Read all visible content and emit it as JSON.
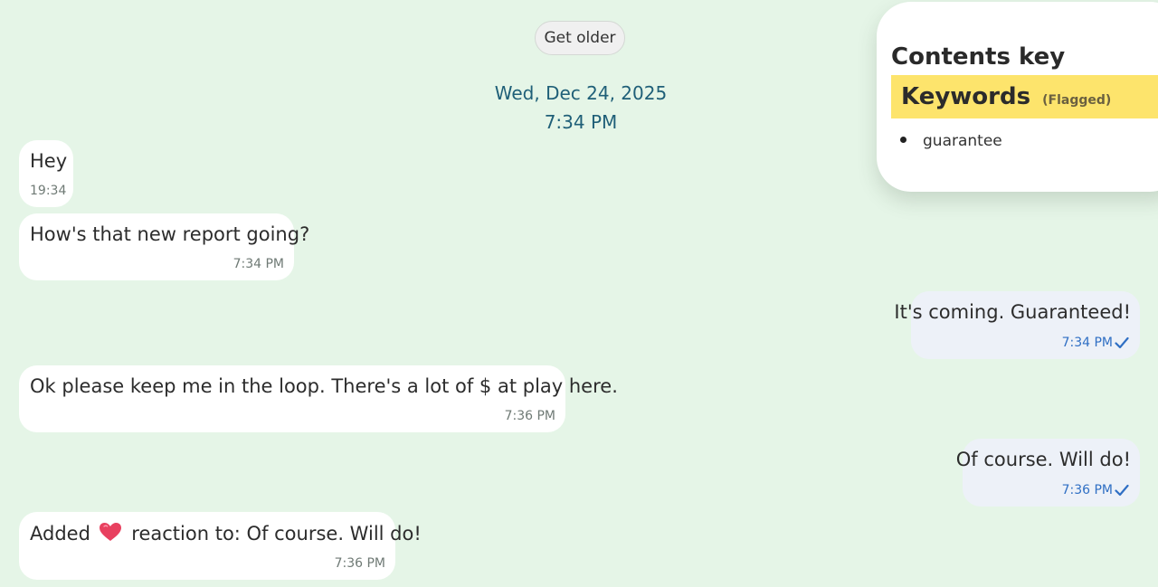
{
  "header": {
    "get_older_label": "Get older",
    "date": "Wed, Dec 24, 2025",
    "time": "7:34 PM"
  },
  "messages": [
    {
      "direction": "incoming",
      "text": "Hey",
      "time": "19:34"
    },
    {
      "direction": "incoming",
      "text": "How's that new report going?",
      "time": "7:34 PM"
    },
    {
      "direction": "outgoing",
      "text": "It's coming. Guaranteed!",
      "time": "7:34 PM",
      "status_icon": "check-icon"
    },
    {
      "direction": "incoming",
      "text": "Ok please keep me in the loop. There's a lot of $ at play here.",
      "time": "7:36 PM"
    },
    {
      "direction": "outgoing",
      "text": "Of course. Will do!",
      "time": "7:36 PM",
      "status_icon": "check-icon"
    },
    {
      "direction": "incoming",
      "text_before": "Added",
      "reaction_icon": "heart-icon",
      "text_after": "reaction to: Of course. Will do!",
      "time": "7:36 PM"
    }
  ],
  "contents_key": {
    "title": "Contents key",
    "section_title": "Keywords",
    "section_tag": "(Flagged)",
    "keywords": [
      "guarantee"
    ]
  },
  "colors": {
    "background": "#e5f5e7",
    "incoming_bubble": "#ffffff",
    "outgoing_bubble": "#edf1f8",
    "date_text": "#1f5f78",
    "outgoing_time": "#2f6fc4",
    "keyword_highlight": "#fde46c"
  }
}
